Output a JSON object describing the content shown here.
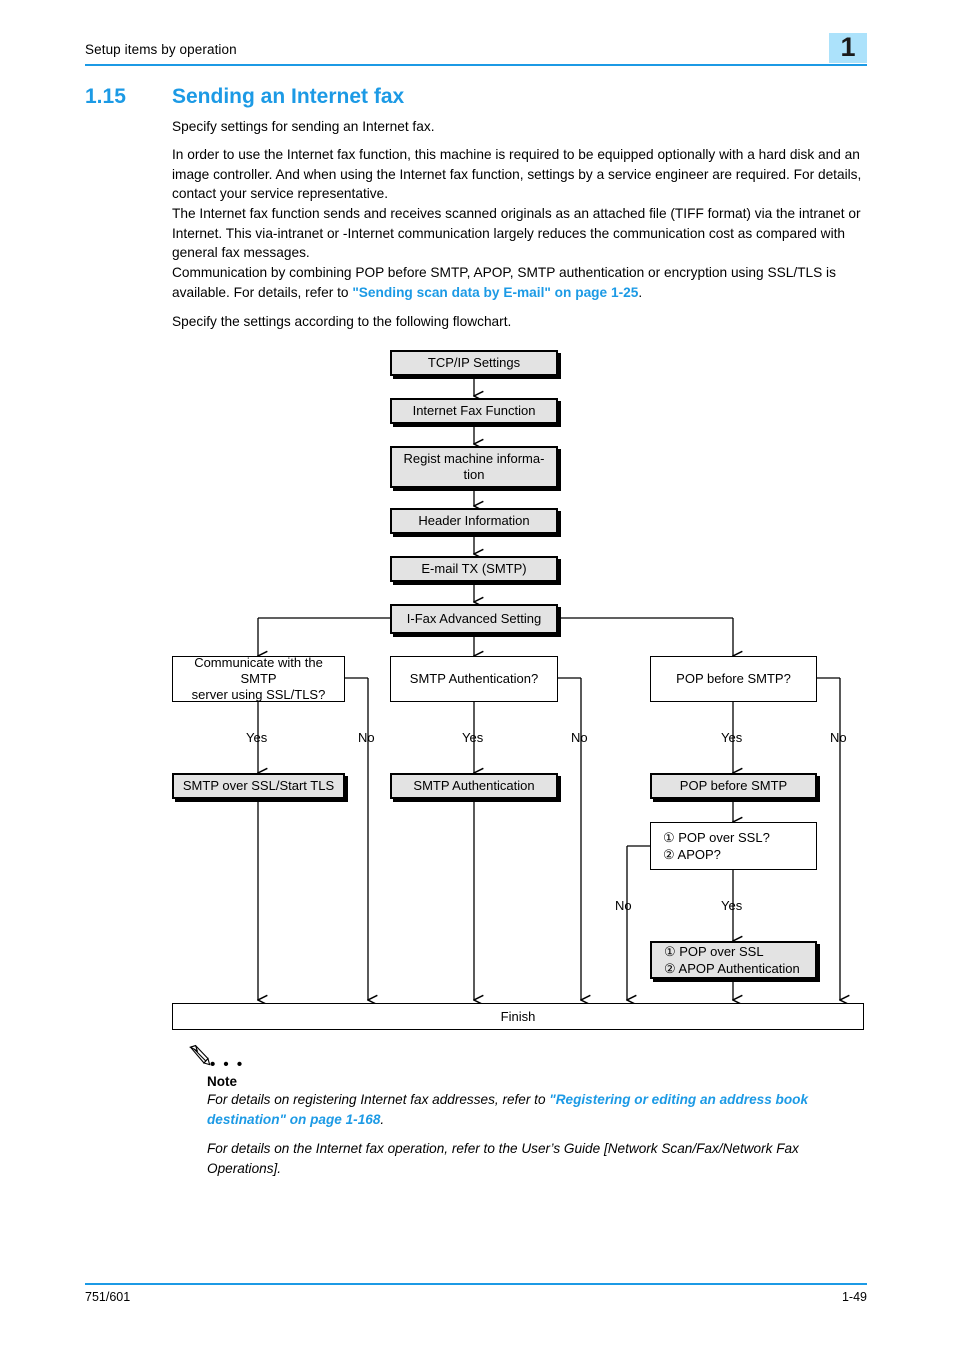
{
  "header": {
    "running_head": "Setup items by operation",
    "chapter_number": "1",
    "accent_color": "#1c9ae5",
    "chapter_box_color": "#ace2fb"
  },
  "section": {
    "number": "1.15",
    "title": "Sending an Internet fax"
  },
  "paragraphs": {
    "p1": "Specify settings for sending an Internet fax.",
    "p2": "In order to use the Internet fax function, this machine is required to be equipped optionally with a hard disk and an image controller. And when using the Internet fax function, settings by a service engineer are required. For details, contact your service representative.",
    "p3": "The Internet fax function sends and receives scanned originals as an attached file (TIFF format) via the intranet or Internet. This via-intranet or -Internet communication largely reduces the communication cost as compared with general fax messages.",
    "p4_pre": "Communication by combining POP before SMTP, APOP, SMTP authentication or encryption using SSL/TLS is available. For details, refer to ",
    "p4_link": "\"Sending scan data by E-mail\" on page 1-25",
    "p4_post": ".",
    "p5": "Specify the settings according to the following flowchart."
  },
  "flowchart": {
    "boxes": {
      "tcpip": "TCP/IP Settings",
      "ifax_function": "Internet Fax Function",
      "regist_machine": "Regist machine informa-\ntion",
      "header_info": "Header Information",
      "email_tx": "E-mail TX (SMTP)",
      "ifax_advanced": "I-Fax Advanced Setting",
      "q_ssl": "Communicate with the SMTP\nserver using SSL/TLS?",
      "q_smtp_auth": "SMTP Authentication?",
      "q_pop_before_smtp": "POP before SMTP?",
      "a_smtp_ssl": "SMTP over SSL/Start TLS",
      "a_smtp_auth": "SMTP Authentication",
      "a_pop_before_smtp": "POP before SMTP",
      "q_pop_ssl_apop_l1": "① POP over SSL?",
      "q_pop_ssl_apop_l2": "② APOP?",
      "a_pop_ssl_apop_l1": "① POP over SSL",
      "a_pop_ssl_apop_l2": "② APOP Authentication",
      "finish": "Finish"
    },
    "labels": {
      "yes1": "Yes",
      "no1": "No",
      "yes2": "Yes",
      "no2": "No",
      "yes3": "Yes",
      "no3": "No",
      "no4": "No",
      "yes4": "Yes"
    }
  },
  "note": {
    "dots": "• • •",
    "title": "Note",
    "n1_pre": "For details on registering Internet fax addresses, refer to ",
    "n1_link": "\"Registering or editing an address book destination\" on page 1-168",
    "n1_post": ".",
    "n2": "For details on the Internet fax operation, refer to the User’s Guide [Network Scan/Fax/Network Fax Operations]."
  },
  "footer": {
    "left": "751/601",
    "right": "1-49"
  }
}
